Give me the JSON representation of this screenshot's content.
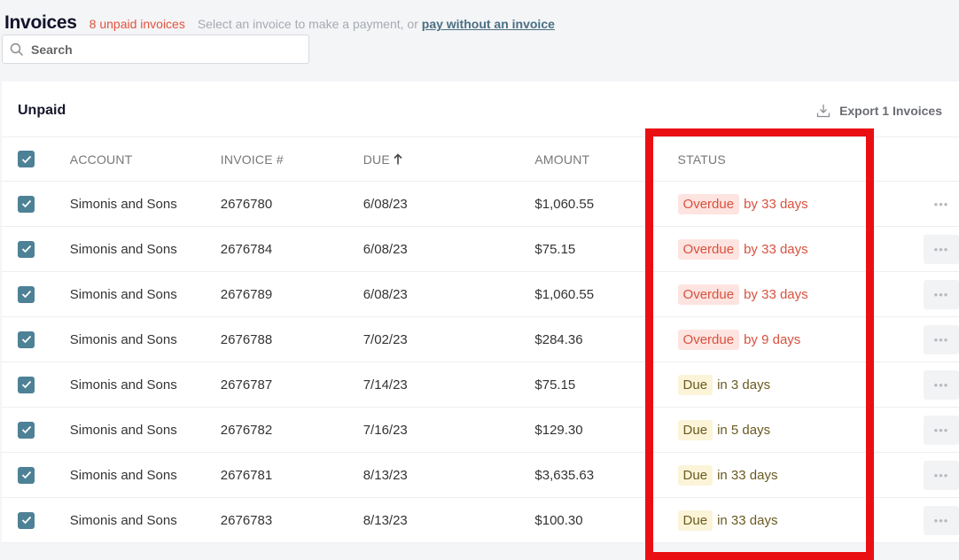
{
  "header": {
    "title": "Invoices",
    "unpaid_count": "8 unpaid invoices",
    "hint": "Select an invoice to make a payment, or",
    "hint_link": "pay without an invoice"
  },
  "search": {
    "placeholder": "Search"
  },
  "section": {
    "title": "Unpaid",
    "export_label": "Export 1 Invoices"
  },
  "columns": {
    "account": "ACCOUNT",
    "invoice": "INVOICE #",
    "due": "DUE",
    "amount": "AMOUNT",
    "status": "STATUS"
  },
  "rows": [
    {
      "account": "Simonis and Sons",
      "invoice": "2676780",
      "due": "6/08/23",
      "amount": "$1,060.55",
      "status_badge": "Overdue",
      "status_text": "by 33 days",
      "status_kind": "overdue"
    },
    {
      "account": "Simonis and Sons",
      "invoice": "2676784",
      "due": "6/08/23",
      "amount": "$75.15",
      "status_badge": "Overdue",
      "status_text": "by 33 days",
      "status_kind": "overdue"
    },
    {
      "account": "Simonis and Sons",
      "invoice": "2676789",
      "due": "6/08/23",
      "amount": "$1,060.55",
      "status_badge": "Overdue",
      "status_text": "by 33 days",
      "status_kind": "overdue"
    },
    {
      "account": "Simonis and Sons",
      "invoice": "2676788",
      "due": "7/02/23",
      "amount": "$284.36",
      "status_badge": "Overdue",
      "status_text": "by 9 days",
      "status_kind": "overdue"
    },
    {
      "account": "Simonis and Sons",
      "invoice": "2676787",
      "due": "7/14/23",
      "amount": "$75.15",
      "status_badge": "Due",
      "status_text": "in 3 days",
      "status_kind": "due"
    },
    {
      "account": "Simonis and Sons",
      "invoice": "2676782",
      "due": "7/16/23",
      "amount": "$129.30",
      "status_badge": "Due",
      "status_text": "in 5 days",
      "status_kind": "due"
    },
    {
      "account": "Simonis and Sons",
      "invoice": "2676781",
      "due": "8/13/23",
      "amount": "$3,635.63",
      "status_badge": "Due",
      "status_text": "in 33 days",
      "status_kind": "due"
    },
    {
      "account": "Simonis and Sons",
      "invoice": "2676783",
      "due": "8/13/23",
      "amount": "$100.30",
      "status_badge": "Due",
      "status_text": "in 33 days",
      "status_kind": "due"
    }
  ],
  "icons": {
    "search": "search-icon",
    "export": "download-icon",
    "sort": "arrow-up-icon",
    "row_menu": "more-horizontal-icon",
    "checkbox": "check-icon"
  },
  "colors": {
    "accent": "#4d8196",
    "overdue": "#d9513e",
    "due": "#6a5a20",
    "highlight": "#ea0f13"
  }
}
